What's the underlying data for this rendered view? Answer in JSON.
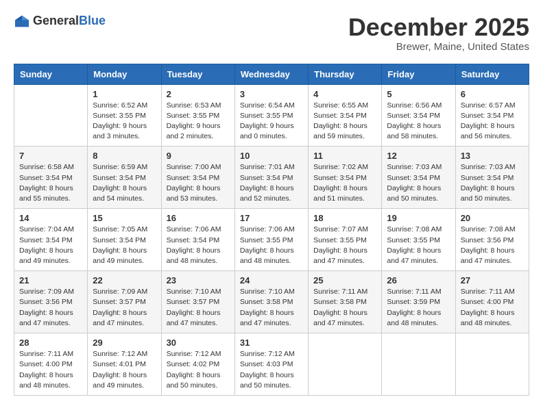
{
  "header": {
    "logo_general": "General",
    "logo_blue": "Blue",
    "month_year": "December 2025",
    "location": "Brewer, Maine, United States"
  },
  "days_of_week": [
    "Sunday",
    "Monday",
    "Tuesday",
    "Wednesday",
    "Thursday",
    "Friday",
    "Saturday"
  ],
  "weeks": [
    [
      {
        "day": "",
        "info": ""
      },
      {
        "day": "1",
        "info": "Sunrise: 6:52 AM\nSunset: 3:55 PM\nDaylight: 9 hours\nand 3 minutes."
      },
      {
        "day": "2",
        "info": "Sunrise: 6:53 AM\nSunset: 3:55 PM\nDaylight: 9 hours\nand 2 minutes."
      },
      {
        "day": "3",
        "info": "Sunrise: 6:54 AM\nSunset: 3:55 PM\nDaylight: 9 hours\nand 0 minutes."
      },
      {
        "day": "4",
        "info": "Sunrise: 6:55 AM\nSunset: 3:54 PM\nDaylight: 8 hours\nand 59 minutes."
      },
      {
        "day": "5",
        "info": "Sunrise: 6:56 AM\nSunset: 3:54 PM\nDaylight: 8 hours\nand 58 minutes."
      },
      {
        "day": "6",
        "info": "Sunrise: 6:57 AM\nSunset: 3:54 PM\nDaylight: 8 hours\nand 56 minutes."
      }
    ],
    [
      {
        "day": "7",
        "info": "Sunrise: 6:58 AM\nSunset: 3:54 PM\nDaylight: 8 hours\nand 55 minutes."
      },
      {
        "day": "8",
        "info": "Sunrise: 6:59 AM\nSunset: 3:54 PM\nDaylight: 8 hours\nand 54 minutes."
      },
      {
        "day": "9",
        "info": "Sunrise: 7:00 AM\nSunset: 3:54 PM\nDaylight: 8 hours\nand 53 minutes."
      },
      {
        "day": "10",
        "info": "Sunrise: 7:01 AM\nSunset: 3:54 PM\nDaylight: 8 hours\nand 52 minutes."
      },
      {
        "day": "11",
        "info": "Sunrise: 7:02 AM\nSunset: 3:54 PM\nDaylight: 8 hours\nand 51 minutes."
      },
      {
        "day": "12",
        "info": "Sunrise: 7:03 AM\nSunset: 3:54 PM\nDaylight: 8 hours\nand 50 minutes."
      },
      {
        "day": "13",
        "info": "Sunrise: 7:03 AM\nSunset: 3:54 PM\nDaylight: 8 hours\nand 50 minutes."
      }
    ],
    [
      {
        "day": "14",
        "info": "Sunrise: 7:04 AM\nSunset: 3:54 PM\nDaylight: 8 hours\nand 49 minutes."
      },
      {
        "day": "15",
        "info": "Sunrise: 7:05 AM\nSunset: 3:54 PM\nDaylight: 8 hours\nand 49 minutes."
      },
      {
        "day": "16",
        "info": "Sunrise: 7:06 AM\nSunset: 3:54 PM\nDaylight: 8 hours\nand 48 minutes."
      },
      {
        "day": "17",
        "info": "Sunrise: 7:06 AM\nSunset: 3:55 PM\nDaylight: 8 hours\nand 48 minutes."
      },
      {
        "day": "18",
        "info": "Sunrise: 7:07 AM\nSunset: 3:55 PM\nDaylight: 8 hours\nand 47 minutes."
      },
      {
        "day": "19",
        "info": "Sunrise: 7:08 AM\nSunset: 3:55 PM\nDaylight: 8 hours\nand 47 minutes."
      },
      {
        "day": "20",
        "info": "Sunrise: 7:08 AM\nSunset: 3:56 PM\nDaylight: 8 hours\nand 47 minutes."
      }
    ],
    [
      {
        "day": "21",
        "info": "Sunrise: 7:09 AM\nSunset: 3:56 PM\nDaylight: 8 hours\nand 47 minutes."
      },
      {
        "day": "22",
        "info": "Sunrise: 7:09 AM\nSunset: 3:57 PM\nDaylight: 8 hours\nand 47 minutes."
      },
      {
        "day": "23",
        "info": "Sunrise: 7:10 AM\nSunset: 3:57 PM\nDaylight: 8 hours\nand 47 minutes."
      },
      {
        "day": "24",
        "info": "Sunrise: 7:10 AM\nSunset: 3:58 PM\nDaylight: 8 hours\nand 47 minutes."
      },
      {
        "day": "25",
        "info": "Sunrise: 7:11 AM\nSunset: 3:58 PM\nDaylight: 8 hours\nand 47 minutes."
      },
      {
        "day": "26",
        "info": "Sunrise: 7:11 AM\nSunset: 3:59 PM\nDaylight: 8 hours\nand 48 minutes."
      },
      {
        "day": "27",
        "info": "Sunrise: 7:11 AM\nSunset: 4:00 PM\nDaylight: 8 hours\nand 48 minutes."
      }
    ],
    [
      {
        "day": "28",
        "info": "Sunrise: 7:11 AM\nSunset: 4:00 PM\nDaylight: 8 hours\nand 48 minutes."
      },
      {
        "day": "29",
        "info": "Sunrise: 7:12 AM\nSunset: 4:01 PM\nDaylight: 8 hours\nand 49 minutes."
      },
      {
        "day": "30",
        "info": "Sunrise: 7:12 AM\nSunset: 4:02 PM\nDaylight: 8 hours\nand 50 minutes."
      },
      {
        "day": "31",
        "info": "Sunrise: 7:12 AM\nSunset: 4:03 PM\nDaylight: 8 hours\nand 50 minutes."
      },
      {
        "day": "",
        "info": ""
      },
      {
        "day": "",
        "info": ""
      },
      {
        "day": "",
        "info": ""
      }
    ]
  ]
}
